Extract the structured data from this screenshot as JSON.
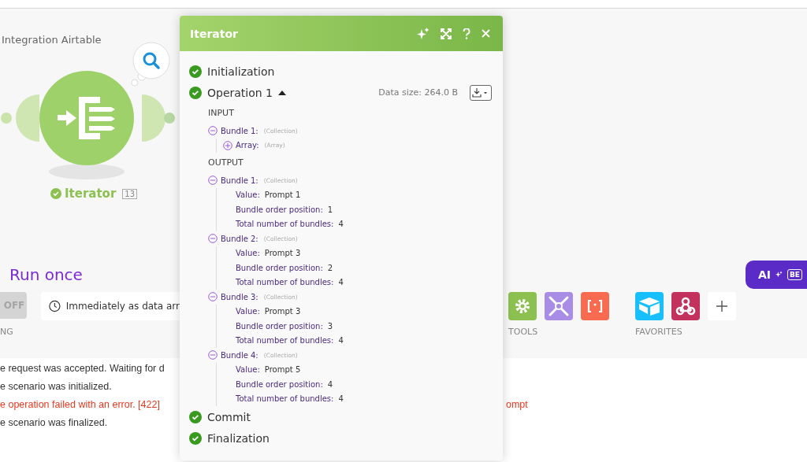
{
  "scenario": {
    "title": "Integration Airtable"
  },
  "module": {
    "name": "Iterator",
    "badge": "13",
    "succeeded": true
  },
  "run_once": "Run once",
  "ai_button": {
    "label": "AI",
    "badge": "BE"
  },
  "schedule": {
    "switch_label": "OFF",
    "on": false,
    "field": "Immediately as data arr",
    "caption": "NG"
  },
  "toolbar_groups": [
    {
      "label": "TOOLS",
      "items": [
        {
          "kind": "gear"
        },
        {
          "kind": "tools"
        },
        {
          "kind": "brackets"
        }
      ]
    },
    {
      "label": "FAVORITES",
      "items": [
        {
          "kind": "airtable"
        },
        {
          "kind": "webhook"
        },
        {
          "kind": "add"
        }
      ]
    }
  ],
  "log": [
    {
      "text": "e request was accepted. Waiting for d",
      "kind": "info"
    },
    {
      "text": "e scenario was initialized.",
      "kind": "info"
    },
    {
      "text": "e operation failed with an error. [422]",
      "tail": "ompt",
      "kind": "error"
    },
    {
      "text": "e scenario was finalized.",
      "kind": "info"
    }
  ],
  "popup": {
    "title": "Iterator",
    "stages": [
      {
        "label": "Initialization",
        "done": true
      },
      {
        "label": "Operation 1",
        "done": true,
        "expanded": true,
        "data_size": "Data size: 264.0 B",
        "sections": [
          {
            "heading": "INPUT",
            "bundles": [
              {
                "label": "Bundle 1:",
                "type": "(Collection)",
                "expanded": true,
                "children": [
                  {
                    "label": "Array:",
                    "type": "(Array)",
                    "expanded": false
                  }
                ]
              }
            ]
          },
          {
            "heading": "OUTPUT",
            "bundles": [
              {
                "label": "Bundle 1:",
                "type": "(Collection)",
                "expanded": true,
                "children": [
                  {
                    "label": "Value:",
                    "value": "Prompt 1"
                  },
                  {
                    "label": "Bundle order position:",
                    "value": "1"
                  },
                  {
                    "label": "Total number of bundles:",
                    "value": "4"
                  }
                ]
              },
              {
                "label": "Bundle 2:",
                "type": "(Collection)",
                "expanded": true,
                "children": [
                  {
                    "label": "Value:",
                    "value": "Prompt 3"
                  },
                  {
                    "label": "Bundle order position:",
                    "value": "2"
                  },
                  {
                    "label": "Total number of bundles:",
                    "value": "4"
                  }
                ]
              },
              {
                "label": "Bundle 3:",
                "type": "(Collection)",
                "expanded": true,
                "children": [
                  {
                    "label": "Value:",
                    "value": "Prompt 3"
                  },
                  {
                    "label": "Bundle order position:",
                    "value": "3"
                  },
                  {
                    "label": "Total number of bundles:",
                    "value": "4"
                  }
                ]
              },
              {
                "label": "Bundle 4:",
                "type": "(Collection)",
                "expanded": true,
                "children": [
                  {
                    "label": "Value:",
                    "value": "Prompt 5"
                  },
                  {
                    "label": "Bundle order position:",
                    "value": "4"
                  },
                  {
                    "label": "Total number of bundles:",
                    "value": "4"
                  }
                ]
              }
            ]
          }
        ]
      },
      {
        "label": "Commit",
        "done": true
      },
      {
        "label": "Finalization",
        "done": true
      }
    ]
  }
}
